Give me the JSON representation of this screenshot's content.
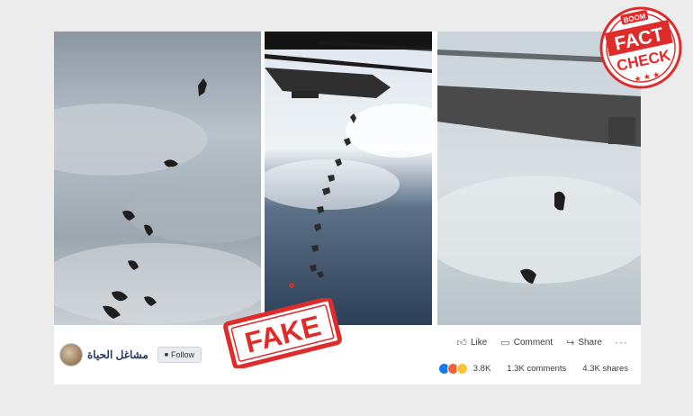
{
  "post": {
    "page_name": "مشاغل الحياة",
    "follow_label": "Follow",
    "actions": {
      "like": "Like",
      "comment": "Comment",
      "share": "Share"
    },
    "stats": {
      "reactions": "3.8K",
      "comments": "1.3K comments",
      "shares": "4.3K shares"
    }
  },
  "overlays": {
    "fake_stamp": "FAKE",
    "fact_check": {
      "brand": "BOOM",
      "line1": "FACT",
      "line2": "CHECK"
    }
  },
  "icons": {
    "like": "thumbs-up-icon",
    "comment": "comment-icon",
    "share": "share-icon",
    "more": "more-options-icon",
    "follow": "follow-icon"
  },
  "colors": {
    "stamp_red": "#e02b2b",
    "link_blue": "#1f3b63",
    "like_blue": "#1877f2"
  }
}
